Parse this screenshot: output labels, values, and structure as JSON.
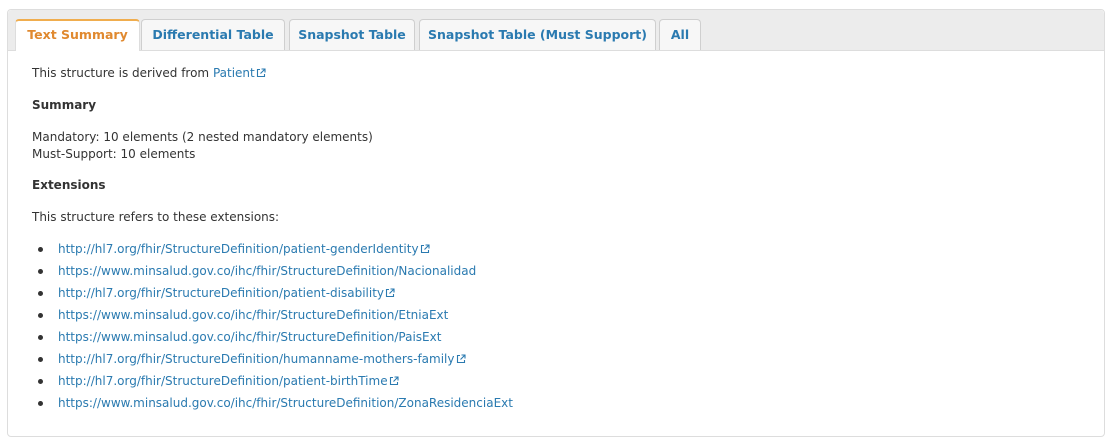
{
  "tabs": [
    {
      "label": "Text Summary"
    },
    {
      "label": "Differential Table"
    },
    {
      "label": "Snapshot Table"
    },
    {
      "label": "Snapshot Table (Must Support)"
    },
    {
      "label": "All"
    }
  ],
  "active_tab": "Text Summary",
  "intro": {
    "prefix": "This structure is derived from ",
    "link": "Patient"
  },
  "summary": {
    "heading": "Summary",
    "mandatory": "Mandatory: 10 elements (2 nested mandatory elements)",
    "must_support": "Must-Support: 10 elements"
  },
  "extensions": {
    "heading": "Extensions",
    "intro": "This structure refers to these extensions:",
    "items": [
      {
        "url": "http://hl7.org/fhir/StructureDefinition/patient-genderIdentity",
        "external": true
      },
      {
        "url": "https://www.minsalud.gov.co/ihc/fhir/StructureDefinition/Nacionalidad",
        "external": false
      },
      {
        "url": "http://hl7.org/fhir/StructureDefinition/patient-disability",
        "external": true
      },
      {
        "url": "https://www.minsalud.gov.co/ihc/fhir/StructureDefinition/EtniaExt",
        "external": false
      },
      {
        "url": "https://www.minsalud.gov.co/ihc/fhir/StructureDefinition/PaisExt",
        "external": false
      },
      {
        "url": "http://hl7.org/fhir/StructureDefinition/humanname-mothers-family",
        "external": true
      },
      {
        "url": "http://hl7.org/fhir/StructureDefinition/patient-birthTime",
        "external": true
      },
      {
        "url": "https://www.minsalud.gov.co/ihc/fhir/StructureDefinition/ZonaResidenciaExt",
        "external": false
      }
    ]
  },
  "colors": {
    "link": "#2a7ab0",
    "active_tab_text": "#e0892f",
    "active_tab_border": "#f0ad4e",
    "tabbar_bg": "#ececec"
  }
}
